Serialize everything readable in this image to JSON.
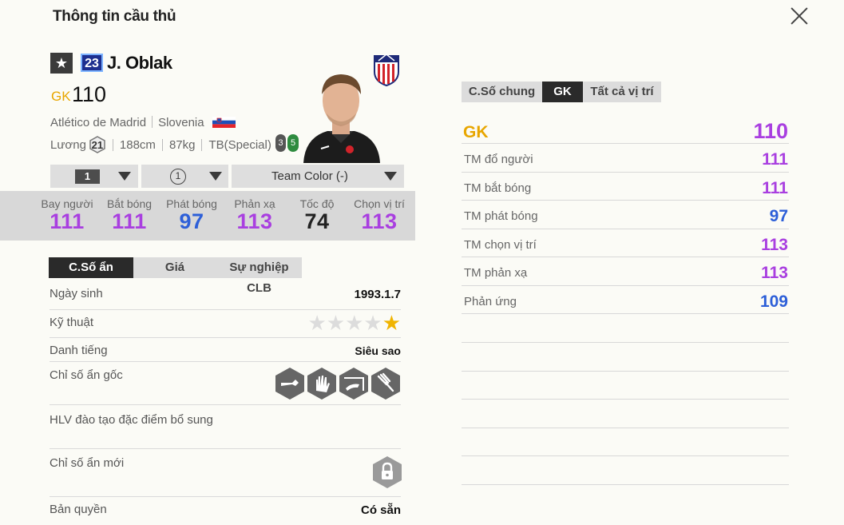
{
  "header": {
    "title": "Thông tin cầu thủ"
  },
  "player": {
    "jersey_number": "23",
    "name": "J. Oblak",
    "position": "GK",
    "overall": "110",
    "club": "Atlético de Madrid",
    "nation": "Slovenia",
    "salary_label": "Lương",
    "salary": "21",
    "height": "188cm",
    "weight": "87kg",
    "body_type": "TB(Special)",
    "skill_a": "3",
    "skill_b": "5"
  },
  "selectors": {
    "level": "1",
    "training": "1",
    "team_color": "Team Color (-)"
  },
  "stats": [
    {
      "label": "Bay người",
      "value": "111",
      "color": "#a93fe0"
    },
    {
      "label": "Bắt bóng",
      "value": "111",
      "color": "#a93fe0"
    },
    {
      "label": "Phát bóng",
      "value": "97",
      "color": "#2d5fd8"
    },
    {
      "label": "Phản xạ",
      "value": "113",
      "color": "#a93fe0"
    },
    {
      "label": "Tốc độ",
      "value": "74",
      "color": "#222222"
    },
    {
      "label": "Chọn vị trí",
      "value": "113",
      "color": "#a93fe0"
    }
  ],
  "left_tabs": [
    "C.Số ẩn",
    "Giá",
    "Sự nghiệp CLB"
  ],
  "details": {
    "birth_label": "Ngày sinh",
    "birth_value": "1993.1.7",
    "skill_label": "Kỹ thuật",
    "skill_stars": 1,
    "fame_label": "Danh tiếng",
    "fame_value": "Siêu sao",
    "traits_label": "Chỉ số ẩn gốc",
    "trait_icons": [
      "long-throw-icon",
      "gk-hand-icon",
      "gk-dive-icon",
      "gk-punch-icon"
    ],
    "coach_label": "HLV đào tạo đặc điểm bổ sung",
    "new_traits_label": "Chỉ số ẩn mới",
    "license_label": "Bản quyền",
    "license_value": "Có sẵn"
  },
  "right_tabs": [
    "C.Số chung",
    "GK",
    "Tất cả vị trí"
  ],
  "position_ratings": [
    {
      "label": "GK",
      "value": "110",
      "color": "#a93fe0"
    },
    {
      "label": "TM đổ người",
      "value": "111",
      "color": "#a93fe0"
    },
    {
      "label": "TM bắt bóng",
      "value": "111",
      "color": "#a93fe0"
    },
    {
      "label": "TM phát bóng",
      "value": "97",
      "color": "#2d5fd8"
    },
    {
      "label": "TM chọn vị trí",
      "value": "113",
      "color": "#a93fe0"
    },
    {
      "label": "TM phản xạ",
      "value": "113",
      "color": "#a93fe0"
    },
    {
      "label": "Phản ứng",
      "value": "109",
      "color": "#2d5fd8"
    }
  ],
  "colors": {
    "accent_gold": "#e8a600",
    "purple": "#a93fe0",
    "blue": "#2d5fd8"
  }
}
